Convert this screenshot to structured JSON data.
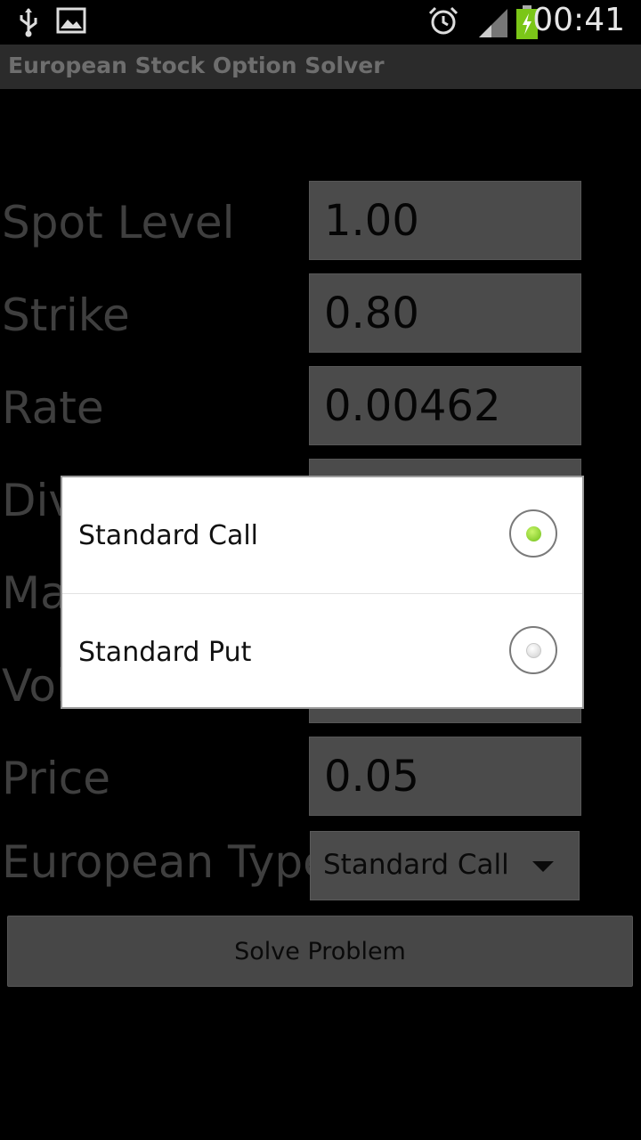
{
  "status_bar": {
    "time": "00:41",
    "icons": [
      "usb-icon",
      "image-icon",
      "alarm-icon",
      "signal-icon",
      "battery-charging-icon"
    ]
  },
  "app": {
    "title": "European Stock Option Solver"
  },
  "form": {
    "rows": [
      {
        "label": "Spot Level",
        "value": "1.00"
      },
      {
        "label": "Strike",
        "value": "0.80"
      },
      {
        "label": "Rate",
        "value": "0.00462"
      },
      {
        "label": "Div",
        "value": ""
      },
      {
        "label": "Ma",
        "value": ""
      },
      {
        "label": "Vol",
        "value": ""
      },
      {
        "label": "Price",
        "value": "0.05"
      }
    ],
    "type_label": "European Type",
    "type_value": "Standard Call",
    "solve_label": "Solve Problem"
  },
  "dialog": {
    "options": [
      {
        "label": "Standard Call",
        "selected": true
      },
      {
        "label": "Standard Put",
        "selected": false
      }
    ]
  },
  "colors": {
    "background": "#000000",
    "titlebar": "#2b2b2b",
    "radio_selected": "#7ed321"
  }
}
